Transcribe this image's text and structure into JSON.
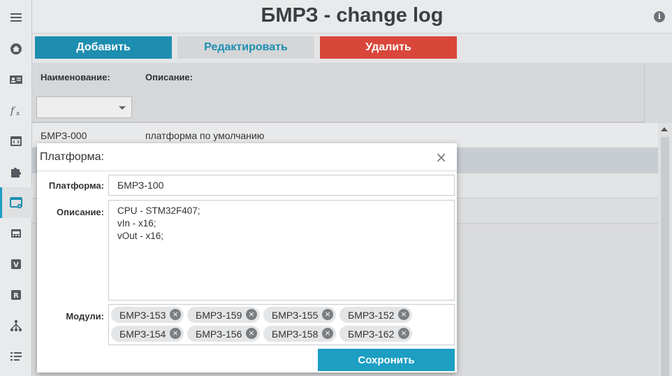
{
  "header": {
    "title": "БМРЗ - change log"
  },
  "toolbar": {
    "add_label": "Добавить",
    "edit_label": "Редактировать",
    "delete_label": "Удалить"
  },
  "filter": {
    "name_label": "Наименование:",
    "desc_label": "Описание:",
    "name_value": ""
  },
  "table": {
    "rows": [
      {
        "name": "БМРЗ-000",
        "desc": "платформа по умолчанию"
      },
      {
        "name": "",
        "desc": ""
      },
      {
        "name": "",
        "desc": ""
      },
      {
        "name": "",
        "desc": ""
      }
    ]
  },
  "modal": {
    "title": "Платформа:",
    "close": "×",
    "platform_label": "Платформа:",
    "platform_value": "БМРЗ-100",
    "desc_label": "Описание:",
    "desc_value": "CPU - STM32F407;\nvIn - x16;\nvOut - x16;",
    "modules_label": "Модули:",
    "modules": [
      "БМРЗ-153",
      "БМРЗ-159",
      "БМРЗ-155",
      "БМРЗ-152",
      "БМРЗ-154",
      "БМРЗ-156",
      "БМРЗ-158",
      "БМРЗ-162"
    ],
    "chip_remove": "×",
    "save_label": "Сохронить"
  },
  "sidebar": {
    "items": [
      "menu-icon",
      "home-icon",
      "contact-card-icon",
      "function-icon",
      "code-window-icon",
      "puzzle-icon",
      "settings-window-icon",
      "hardware-icon",
      "v-badge-icon",
      "r-badge-icon",
      "hierarchy-icon",
      "list-icon"
    ],
    "active_index": 6
  },
  "colors": {
    "accent": "#1d8eb0",
    "danger": "#d9473a",
    "save": "#1d9ec3"
  }
}
